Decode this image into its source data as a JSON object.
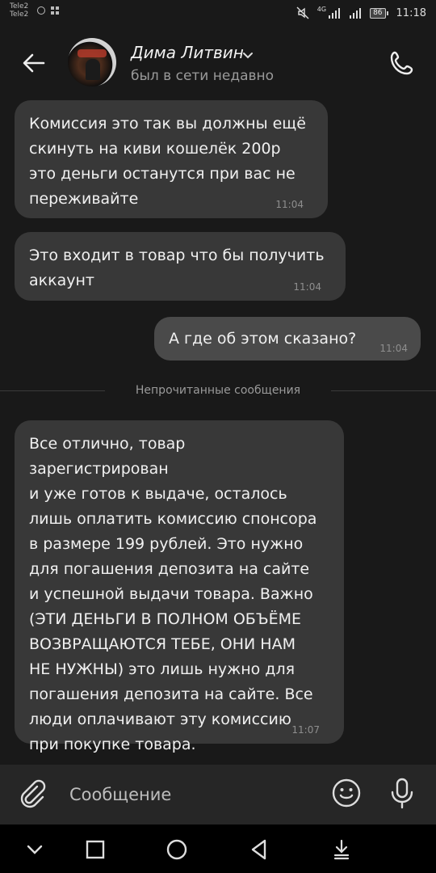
{
  "status_bar": {
    "carrier1": "Tele2",
    "carrier2": "Tele2",
    "network": "4G",
    "battery": "86",
    "time": "11:18"
  },
  "header": {
    "contact_name": "Дима Литвин",
    "contact_status": "был в сети недавно"
  },
  "messages": [
    {
      "direction": "incoming",
      "text": "Комиссия это так вы должны ещё\nскинуть на киви кошелёк 200р\nэто деньги останутся при вас не\nпереживайте",
      "time": "11:04"
    },
    {
      "direction": "incoming",
      "text": "Это входит в товар что бы получить\nаккаунт",
      "time": "11:04"
    },
    {
      "direction": "outgoing",
      "text": "А где об этом сказано?",
      "time": "11:04"
    },
    {
      "direction": "incoming",
      "text": "Все отлично, товар зарегистрирован\nи уже готов к выдаче, осталось\nлишь оплатить комиссию спонсора\nв размере 199 рублей. Это нужно\nдля погашения депозита на сайте\nи успешной выдачи товара. Важно\n(ЭТИ ДЕНЬГИ В ПОЛНОМ ОБЪЁМЕ\nВОЗВРАЩАЮТСЯ ТЕБЕ, ОНИ НАМ\nНЕ НУЖНЫ) это лишь нужно для\nпогашения депозита на сайте. Все\nлюди оплачивают эту комиссию\nпри покупке товара.",
      "time": "11:07"
    }
  ],
  "unread_divider": "Непрочитанные сообщения",
  "composer": {
    "placeholder": "Сообщение"
  },
  "icons": {
    "back": "arrow-left-icon",
    "call": "phone-icon",
    "attach": "paperclip-icon",
    "emoji": "smiley-icon",
    "mic": "microphone-icon"
  }
}
